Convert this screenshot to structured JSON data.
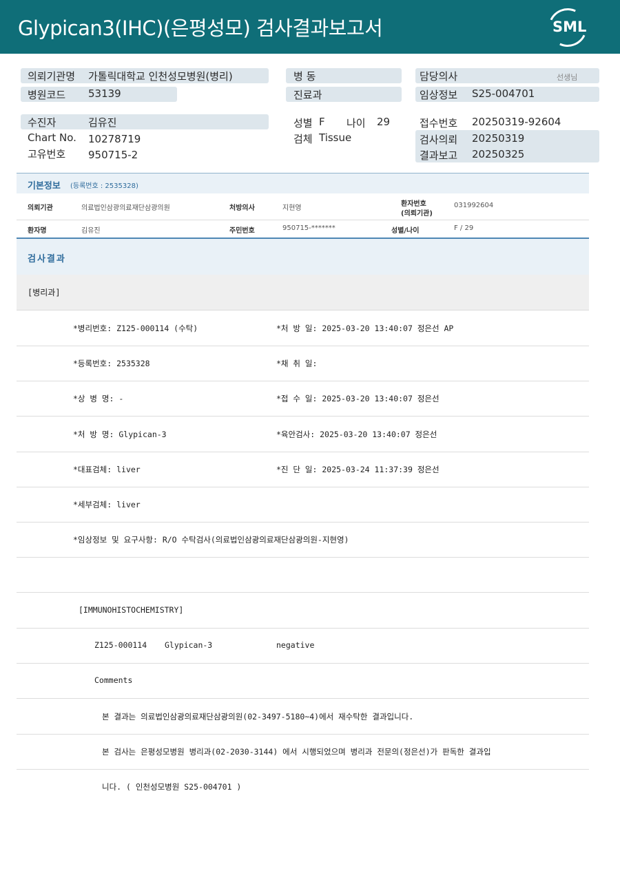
{
  "header": {
    "title": "Glypican3(IHC)(은평성모) 검사결과보고서",
    "logo_text": "SML",
    "bg_color": "#0f6e78"
  },
  "top": {
    "request_org_label": "의뢰기관명",
    "request_org": "가톨릭대학교 인천성모병원(병리)",
    "hospital_code_label": "병원코드",
    "hospital_code": "53139",
    "ward_label": "병    동",
    "dept_label": "진료과",
    "doctor_label": "담당의사",
    "doctor_suffix": "선생님",
    "clinical_label": "임상정보",
    "clinical": "S25-004701",
    "patient_label": "수진자",
    "patient": "김유진",
    "chart_label": "Chart No.",
    "chart": "10278719",
    "unique_label": "고유번호",
    "unique": "950715-2",
    "sex_label": "성별",
    "sex": "F",
    "age_label": "나이",
    "age": "29",
    "specimen_label": "검체",
    "specimen": "Tissue",
    "receipt_label": "접수번호",
    "receipt": "20250319-92604",
    "request_label": "검사의뢰",
    "request": "20250319",
    "report_label": "결과보고",
    "report": "20250325"
  },
  "basic": {
    "title": "기본정보",
    "sub": "(등록번호 : 2535328)",
    "org_key": "의뢰기관",
    "org_val": "의료법인삼광의료재단삼광의원",
    "presc_doc_key": "처방의사",
    "presc_doc_val": "지현영",
    "pt_no_key1": "환자번호",
    "pt_no_key2": "(의뢰기관)",
    "pt_no_val": "031992604",
    "name_key": "환자명",
    "name_val": "김유진",
    "rrn_key": "주민번호",
    "rrn_val": "950715-*******",
    "sexage_key": "성별/나이",
    "sexage_val": "F / 29"
  },
  "result": {
    "title": "검사결과",
    "dept": "[병리과]",
    "lines": [
      {
        "left": "*병리번호: Z125-000114 (수탁)",
        "right": "*처 방 일: 2025-03-20 13:40:07  정은선 AP"
      },
      {
        "left": "*등록번호: 2535328",
        "right": "*채 취 일:"
      },
      {
        "left": "*상 병 명: -",
        "right": "*접 수 일: 2025-03-20 13:40:07  정은선"
      },
      {
        "left": "*처 방 명: Glypican-3",
        "right": "*육안검사: 2025-03-20 13:40:07  정은선"
      },
      {
        "left": "*대표검체: liver",
        "right": "*진 단 일: 2025-03-24 11:37:39  정은선"
      },
      {
        "left": "*세부검체: liver",
        "right": ""
      },
      {
        "left": "*임상정보 및 요구사항: R/O 수탁검사(의료법인삼광의료재단삼광의원-지현영)",
        "right": ""
      }
    ],
    "ihc_header": "[IMMUNOHISTOCHEMISTRY]",
    "ihc_id": "Z125-000114",
    "ihc_marker": "Glypican-3",
    "ihc_result": "negative",
    "comments": "Comments",
    "comment1": "본 결과는 의료법인삼광의료재단삼광의원(02-3497-5180~4)에서 재수탁한 결과입니다.",
    "comment2": "본 검사는 은평성모병원 병리과(02-2030-3144) 에서 시행되었으며 병리과 전문의(정은선)가 판독한 결과입",
    "comment3": "니다. ( 인천성모병원 S25-004701 )"
  }
}
